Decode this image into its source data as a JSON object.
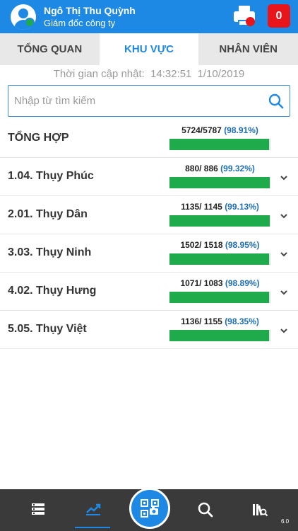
{
  "header": {
    "user_name": "Ngô Thị Thu Quỳnh",
    "user_role": "Giám đốc công ty",
    "notification_count": "0"
  },
  "tabs": [
    {
      "label": "TỔNG QUAN",
      "active": false
    },
    {
      "label": "KHU VỰC",
      "active": true
    },
    {
      "label": "NHÂN VIÊN",
      "active": false
    }
  ],
  "update": {
    "label": "Thời gian cập nhật:",
    "time": "14:32:51",
    "date": "1/10/2019"
  },
  "search": {
    "placeholder": "Nhập từ tìm kiếm",
    "value": ""
  },
  "summary": {
    "label": "TỔNG HỢP",
    "stat": "5724/5787",
    "percent": "(98.91%)",
    "fill": 0.9891
  },
  "areas": [
    {
      "label": "1.04. Thụy Phúc",
      "stat": "880/ 886",
      "percent": "(99.32%)",
      "fill": 0.9932
    },
    {
      "label": "2.01. Thụy Dân",
      "stat": "1135/ 1145",
      "percent": "(99.13%)",
      "fill": 0.9913
    },
    {
      "label": "3.03. Thụy Ninh",
      "stat": "1502/ 1518",
      "percent": "(98.95%)",
      "fill": 0.9895
    },
    {
      "label": "4.02. Thụy Hưng",
      "stat": "1071/ 1083",
      "percent": "(98.89%)",
      "fill": 0.9889
    },
    {
      "label": "5.05. Thụy Việt",
      "stat": "1136/ 1155",
      "percent": "(98.35%)",
      "fill": 0.9835
    }
  ],
  "bottom_nav": {
    "items": [
      "list-icon",
      "chart-icon",
      "qr-scan-icon",
      "search-icon",
      "book-search-icon"
    ],
    "active": "chart-icon"
  },
  "version": "6.0",
  "colors": {
    "primary": "#1e88e5",
    "progress": "#1faa4b",
    "alert": "#e8151b",
    "nav_bg": "#3a3a3a"
  }
}
